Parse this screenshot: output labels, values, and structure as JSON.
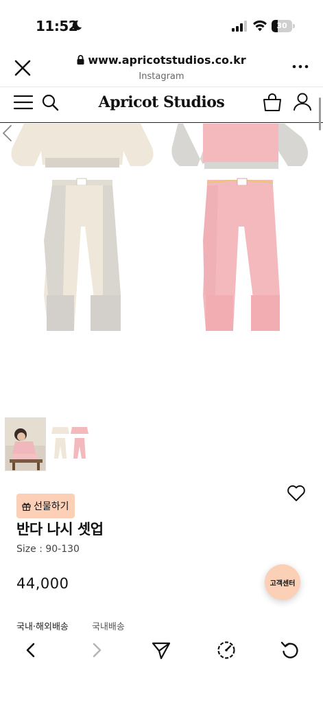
{
  "status_bar": {
    "time": "11:52",
    "battery_text": "30",
    "battery_level": 0.3
  },
  "browser": {
    "url": "www.apricotstudios.co.kr",
    "source": "Instagram"
  },
  "site": {
    "logo": "Apricot Studios"
  },
  "product": {
    "gift_label": "선물하기",
    "name": "반다 나시 셋업",
    "size": "Size : 90-130",
    "price": "44,000"
  },
  "customer_service": {
    "label": "고객센터"
  },
  "shipping_tabs": [
    "국내·해외배송",
    "국내배송"
  ],
  "colors": {
    "accent": "#fbd0b6",
    "pink_garment": "#f3b9bd",
    "cream_garment": "#efe7d9",
    "grey_garment": "#d8d6d3"
  },
  "icons": {
    "close": "close-icon",
    "lock": "lock-icon",
    "more": "more-icon",
    "menu": "menu-icon",
    "search": "search-icon",
    "cart": "shopping-bag-icon",
    "user": "user-icon",
    "wish": "heart-icon",
    "gift": "gift-icon",
    "back": "chevron-left-icon",
    "forward": "chevron-right-icon",
    "share": "send-icon",
    "speed": "speedometer-icon",
    "refresh": "refresh-icon"
  }
}
